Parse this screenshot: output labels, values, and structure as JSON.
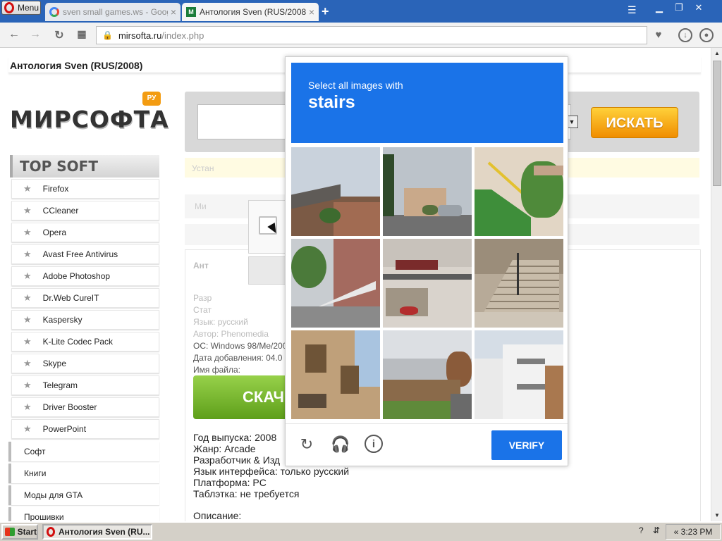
{
  "browser": {
    "menu_label": "Menu",
    "tabs": [
      {
        "title": "sven small games.ws - Goog",
        "favicon": "google-favicon",
        "active": false
      },
      {
        "title": "Антология Sven (RUS/2008)",
        "favicon": "mirsofta-favicon",
        "active": true
      }
    ],
    "new_tab_icon": "plus-icon",
    "url_host": "mirsofta.ru",
    "url_path": "/index.php",
    "secure": true
  },
  "page": {
    "title": "Антология Sven (RUS/2008)",
    "logo_text": "МИРСОФТА",
    "logo_badge": "РУ",
    "search_button": "ИСКАТЬ",
    "top_soft_heading": "TOP SOFT",
    "top_soft": [
      "Firefox",
      "CCleaner",
      "Opera",
      "Avast Free Antivirus",
      "Adobe Photoshop",
      "Dr.Web CureIT",
      "Kaspersky",
      "K-Lite Codec Pack",
      "Skype",
      "Telegram",
      "Driver Booster",
      "PowerPoint"
    ],
    "categories": [
      "Софт",
      "Книги",
      "Моды для GTA",
      "Прошивки"
    ],
    "yellow_notice": "Устан",
    "grey_label": "Ми",
    "faded_title": "Ант",
    "faded_lines": [
      "Разр",
      "Стат",
      "Язык: русский"
    ],
    "meta_author": "Автор: Phenomedia",
    "meta_os": "ОС: Windows 98/Me/200",
    "meta_added": "Дата добавления: 04.0",
    "meta_filename": "Имя файла:",
    "download_button": "СКАЧ",
    "info": {
      "year": "Год выпуска: 2008",
      "genre": "Жанр: Arcade",
      "developer": "Разработчик & Изд",
      "language": "Язык интерфейса: только русский",
      "platform": "Платформа: PC",
      "tablet": "Таблэтка: не требуется"
    },
    "description_title": "Описание:"
  },
  "recaptcha": {
    "instruction": "Select all images with",
    "target": "stairs",
    "verify_label": "VERIFY",
    "footer_icons": [
      "reload-icon",
      "audio-icon",
      "info-icon"
    ],
    "tiles": [
      "house-rooftop",
      "street-with-car",
      "green-stairs-yellow-railing",
      "white-railing-stairs",
      "storefront-motorcycle",
      "concrete-stairs",
      "ornate-facade",
      "suburban-street-fence",
      "white-building-balconies"
    ]
  },
  "taskbar": {
    "start_label": "Start",
    "task_label": "Антология Sven (RU...",
    "clock": "3:23 PM"
  }
}
